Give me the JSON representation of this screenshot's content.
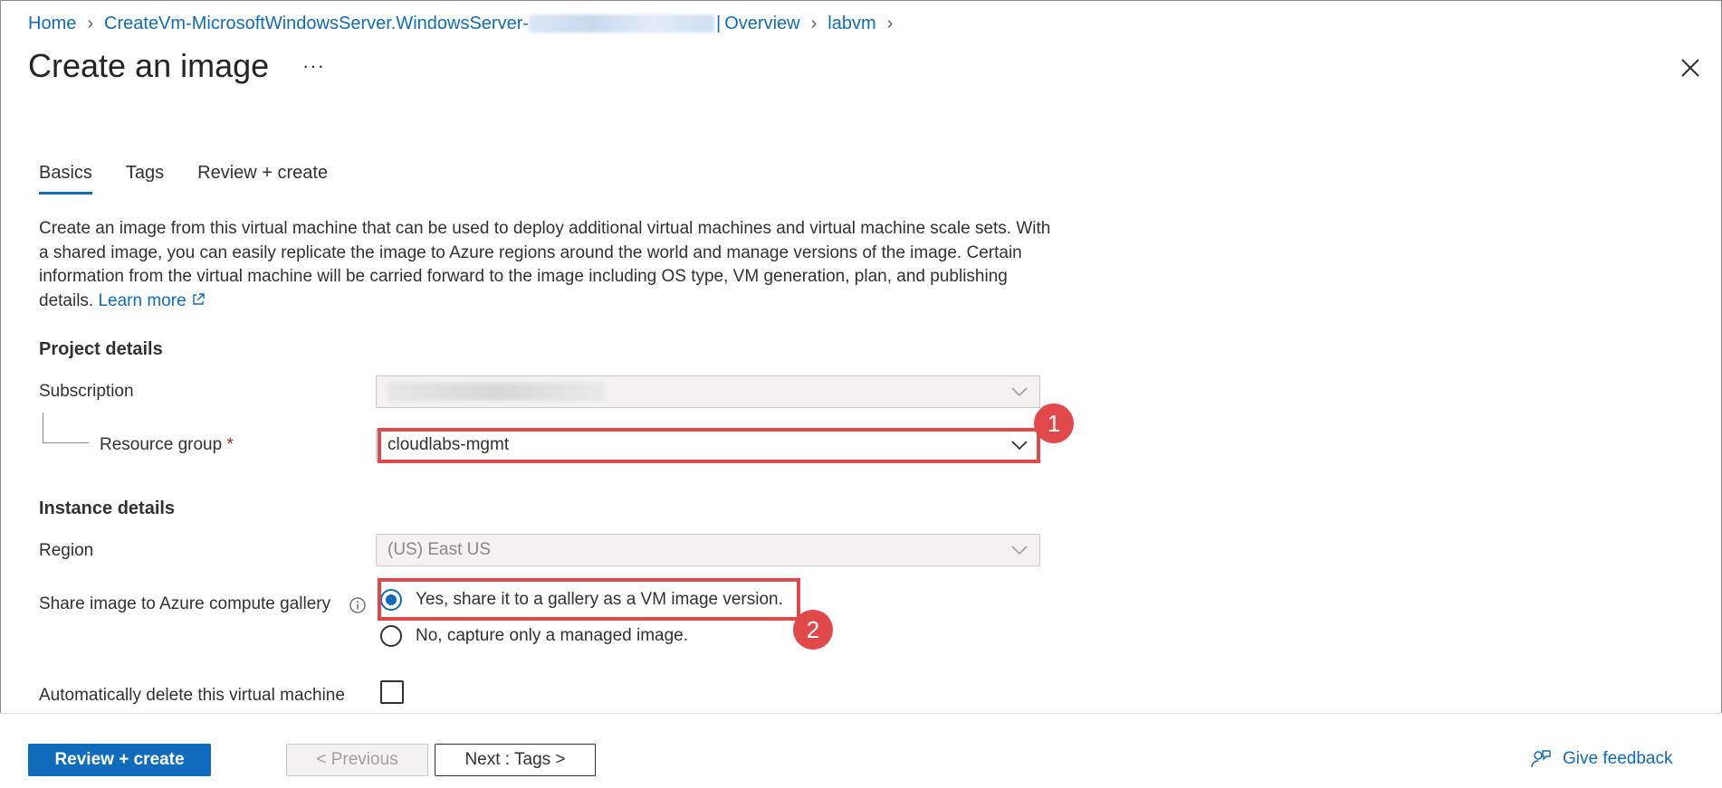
{
  "breadcrumb": {
    "home": "Home",
    "deployment_prefix": "CreateVm-MicrosoftWindowsServer.WindowsServer-",
    "separator": "|",
    "overview": "Overview",
    "vm": "labvm"
  },
  "header": {
    "title": "Create an image",
    "more": "···"
  },
  "tabs": [
    {
      "label": "Basics",
      "active": true
    },
    {
      "label": "Tags",
      "active": false
    },
    {
      "label": "Review + create",
      "active": false
    }
  ],
  "description": {
    "text": "Create an image from this virtual machine that can be used to deploy additional virtual machines and virtual machine scale sets. With a shared image, you can easily replicate the image to Azure regions around the world and manage versions of the image. Certain information from the virtual machine will be carried forward to the image including OS type, VM generation, plan, and publishing details.",
    "link": "Learn more"
  },
  "project": {
    "heading": "Project details",
    "subscription_label": "Subscription",
    "resource_group_label": "Resource group",
    "required_mark": "*",
    "resource_group_value": "cloudlabs-mgmt"
  },
  "instance": {
    "heading": "Instance details",
    "region_label": "Region",
    "region_value": "(US) East US",
    "share_label": "Share image to Azure compute gallery",
    "share_options": [
      "Yes, share it to a gallery as a VM image version.",
      "No, capture only a managed image."
    ],
    "selected_option": 0,
    "auto_delete_label": "Automatically delete this virtual machine"
  },
  "annotations": [
    "1",
    "2"
  ],
  "footer": {
    "review_create": "Review + create",
    "previous": "< Previous",
    "next": "Next : Tags >",
    "feedback": "Give feedback"
  },
  "colors": {
    "accent": "#0f6cbd",
    "highlight": "#e0484a"
  }
}
